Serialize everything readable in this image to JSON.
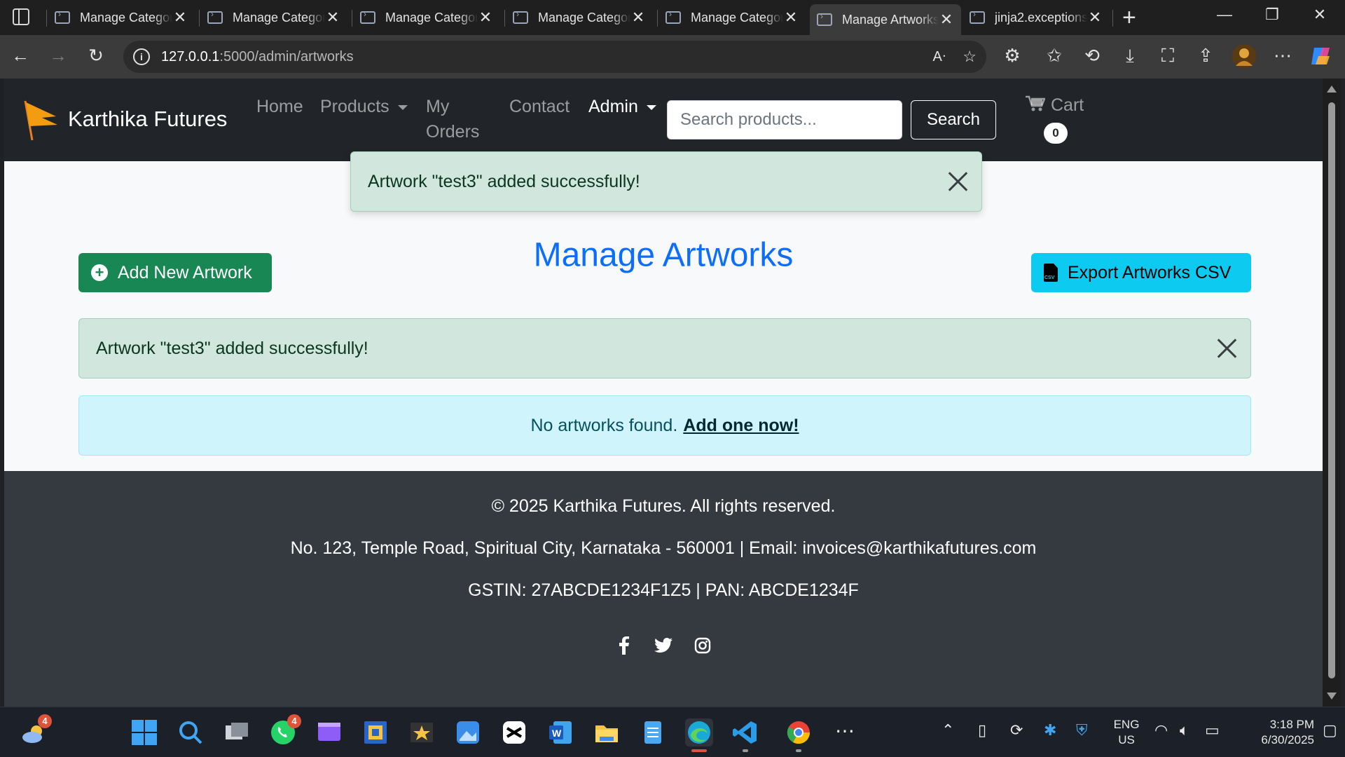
{
  "browser": {
    "tabs": [
      {
        "title": "Manage Categories",
        "active": false
      },
      {
        "title": "Manage Categories",
        "active": false
      },
      {
        "title": "Manage Categories",
        "active": false
      },
      {
        "title": "Manage Categories",
        "active": false
      },
      {
        "title": "Manage Categories",
        "active": false
      },
      {
        "title": "Manage Artworks",
        "active": true
      },
      {
        "title": "jinja2.exceptions",
        "active": false
      }
    ],
    "url_host": "127.0.0.1",
    "url_path": ":5000/admin/artworks"
  },
  "navbar": {
    "brand": "Karthika Futures",
    "links": {
      "home": "Home",
      "products": "Products",
      "my_orders_line1": "My",
      "my_orders_line2": "Orders",
      "contact": "Contact",
      "admin": "Admin"
    },
    "search_placeholder": "Search products...",
    "search_button": "Search",
    "cart_label": "Cart",
    "cart_count": "0"
  },
  "toast": {
    "message": "Artwork \"test3\" added successfully!"
  },
  "main": {
    "title": "Manage Artworks",
    "add_button": "Add New Artwork",
    "export_button": "Export Artworks CSV",
    "alert_message": "Artwork \"test3\" added successfully!",
    "empty_text": "No artworks found.",
    "empty_link": "Add one now!"
  },
  "footer": {
    "copyright": "© 2025 Karthika Futures. All rights reserved.",
    "address": "No. 123, Temple Road, Spiritual City, Karnataka - 560001 | Email: invoices@karthikafutures.com",
    "tax": "GSTIN: 27ABCDE1234F1Z5 | PAN: ABCDE1234F",
    "social_icons": [
      "facebook-icon",
      "twitter-icon",
      "instagram-icon"
    ]
  },
  "taskbar": {
    "weather_badge": "4",
    "whatsapp_badge": "4",
    "lang_line1": "ENG",
    "lang_line2": "US",
    "time": "3:18 PM",
    "date": "6/30/2025"
  },
  "colors": {
    "primary": "#0d6efd",
    "success": "#198754",
    "info": "#0dcaf0",
    "navbar": "#212529",
    "footer": "#343a40"
  }
}
